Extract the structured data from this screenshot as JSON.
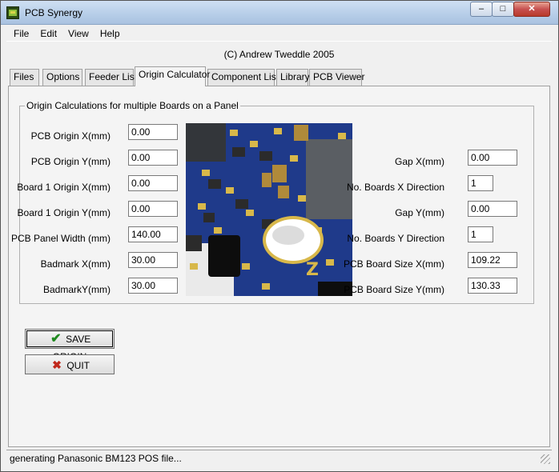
{
  "window": {
    "title": "PCB Synergy",
    "minimize": "–",
    "maximize": "□",
    "close": "✕"
  },
  "menu": [
    "File",
    "Edit",
    "View",
    "Help"
  ],
  "copyright": "(C) Andrew Tweddle 2005",
  "tabs": [
    "Files",
    "Options",
    "Feeder List",
    "Origin Calculator",
    "Component List",
    "Library",
    "PCB Viewer"
  ],
  "active_tab": "Origin Calculator",
  "group_title": "Origin Calculations for multiple Boards on a Panel",
  "left_fields": [
    {
      "label": "PCB Origin X(mm)",
      "value": "0.00"
    },
    {
      "label": "PCB Origin Y(mm)",
      "value": "0.00"
    },
    {
      "label": "Board 1 Origin X(mm)",
      "value": "0.00"
    },
    {
      "label": "Board 1 Origin Y(mm)",
      "value": "0.00"
    },
    {
      "label": "PCB Panel Width (mm)",
      "value": "140.00"
    },
    {
      "label": "Badmark X(mm)",
      "value": "30.00"
    },
    {
      "label": "BadmarkY(mm)",
      "value": "30.00"
    }
  ],
  "right_fields": [
    {
      "label": "Gap X(mm)",
      "value": "0.00"
    },
    {
      "label": "No. Boards X Direction",
      "value": "1"
    },
    {
      "label": "Gap Y(mm)",
      "value": "0.00"
    },
    {
      "label": "No. Boards Y Direction",
      "value": "1"
    },
    {
      "label": "PCB Board Size X(mm)",
      "value": "109.22"
    },
    {
      "label": "PCB Board Size Y(mm)",
      "value": "130.33"
    }
  ],
  "buttons": {
    "save": "SAVE ORIGIN",
    "quit": "QUIT"
  },
  "image_text": "Z",
  "status": "generating Panasonic BM123 POS file...",
  "colors": {
    "pcb_board": "#1f3a8a",
    "pad": "#d8b84a",
    "component": "#2b2b2b",
    "accent_check": "#1f8a1f",
    "accent_cross": "#c0281c"
  }
}
